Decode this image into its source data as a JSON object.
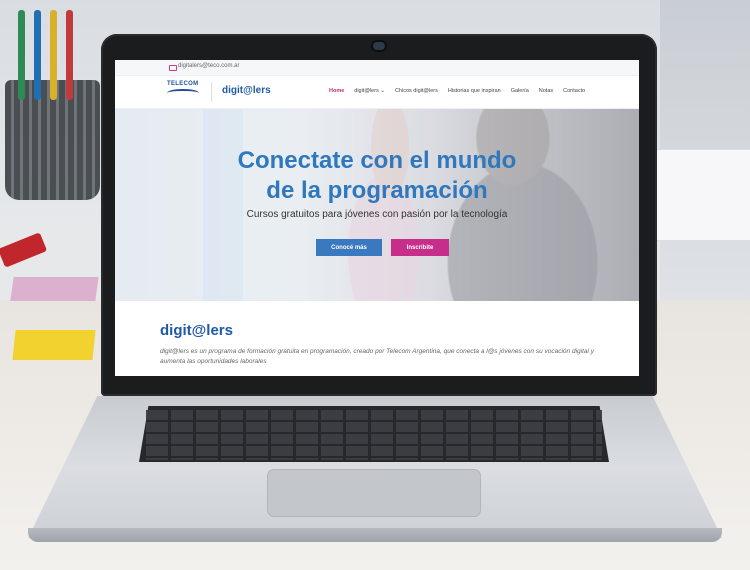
{
  "site": {
    "email": "digitalers@teco.com.ar",
    "telecom_logo": "TELECOM",
    "brand": "digit@lers"
  },
  "nav": {
    "items": [
      {
        "label": "Home",
        "active": true
      },
      {
        "label": "digit@lers ⌄",
        "active": false
      },
      {
        "label": "Chicos digit@lers",
        "active": false
      },
      {
        "label": "Historias que inspiran",
        "active": false
      },
      {
        "label": "Galería",
        "active": false
      },
      {
        "label": "Notas",
        "active": false
      },
      {
        "label": "Contacto",
        "active": false
      }
    ]
  },
  "hero": {
    "title_line1": "Conectate con el mundo",
    "title_line2": "de la programación",
    "subtitle": "Cursos gratuitos para jóvenes con pasión por la tecnología",
    "cta_primary": "Conocé más",
    "cta_secondary": "Inscribite"
  },
  "about": {
    "title": "digit@lers",
    "text": "digit@lers es un programa de formación gratuita en programación, creado por Telecom Argentina, que conecta a l@s jóvenes con su vocación digital y aumenta las oportunidades laborales"
  },
  "colors": {
    "brand_blue": "#2f78be",
    "accent_pink": "#c72d8a"
  }
}
